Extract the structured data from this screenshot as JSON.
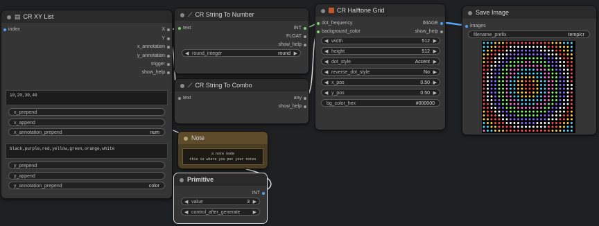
{
  "nodes": {
    "xy_list": {
      "title": "CR XY List",
      "inputs": [
        "index"
      ],
      "outputs": [
        "X",
        "Y",
        "x_annotation",
        "y_annotation",
        "trigger",
        "show_help"
      ],
      "x_values_text": "10,20,30,40",
      "x_widgets": [
        {
          "label": "x_prepend",
          "value": ""
        },
        {
          "label": "x_append",
          "value": ""
        },
        {
          "label": "x_annotation_prepend",
          "value": "num"
        }
      ],
      "y_values_text": "black,purple,red,yellow,green,orange,white",
      "y_widgets": [
        {
          "label": "y_prepend",
          "value": ""
        },
        {
          "label": "y_append",
          "value": ""
        },
        {
          "label": "y_annotation_prepend",
          "value": "color"
        }
      ]
    },
    "string_to_number": {
      "title": "CR String To Number",
      "inputs": [
        "text"
      ],
      "outputs": [
        "INT",
        "FLOAT",
        "show_help"
      ],
      "widget": {
        "label": "round_integer",
        "value": "round"
      }
    },
    "string_to_combo": {
      "title": "CR String To Combo",
      "inputs": [
        "text"
      ],
      "outputs": [
        "any",
        "show_help"
      ]
    },
    "note": {
      "title": "Note",
      "line1": "a note node",
      "line2": "this is where you put your notes"
    },
    "primitive": {
      "title": "Primitive",
      "output": "INT",
      "widgets": [
        {
          "label": "value",
          "value": "3"
        },
        {
          "label": "control_after_generate",
          "value": "increment"
        }
      ]
    },
    "halftone": {
      "title": "CR Halftone Grid",
      "inputs": [
        "dot_frequency",
        "background_color"
      ],
      "outputs": [
        "IMAGE",
        "show_help"
      ],
      "widgets": [
        {
          "label": "width",
          "value": "512"
        },
        {
          "label": "height",
          "value": "512"
        },
        {
          "label": "dot_style",
          "value": "Accent"
        },
        {
          "label": "reverse_dot_style",
          "value": "No"
        },
        {
          "label": "x_pos",
          "value": "0.50"
        },
        {
          "label": "y_pos",
          "value": "0.50"
        },
        {
          "label": "bg_color_hex",
          "value": "#000000"
        }
      ],
      "accent_color": "#c0582c"
    },
    "save_image": {
      "title": "Save Image",
      "inputs": [
        "images"
      ],
      "widget": {
        "label": "filename_prefix",
        "value": "temp/cr"
      }
    }
  },
  "colors": {
    "canvas": "#1f2022",
    "node_body": "#353535",
    "node_header": "#2a2a2a",
    "note_body": "#4a3d22",
    "note_header": "#5e4b2a",
    "wire_blue": "#5aa9ff",
    "wire_white": "#e6e6e6",
    "wire_green": "#8fd48a",
    "dot_palette": [
      "#ff4d4d",
      "#ffd23f",
      "#4dd9ff",
      "#ff7ad9",
      "#7dff6a",
      "#8c6cff",
      "#ffffff"
    ]
  }
}
